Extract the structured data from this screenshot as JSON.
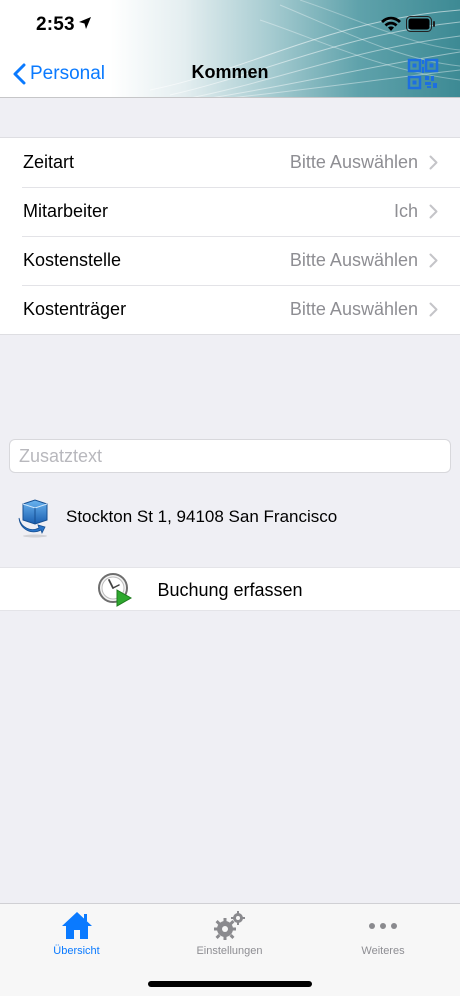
{
  "status_bar": {
    "time": "2:53"
  },
  "nav": {
    "back_label": "Personal",
    "title": "Kommen"
  },
  "form": {
    "rows": [
      {
        "label": "Zeitart",
        "value": "Bitte Auswählen"
      },
      {
        "label": "Mitarbeiter",
        "value": "Ich"
      },
      {
        "label": "Kostenstelle",
        "value": "Bitte Auswählen"
      },
      {
        "label": "Kostenträger",
        "value": "Bitte Auswählen"
      }
    ]
  },
  "extra_text": {
    "placeholder": "Zusatztext",
    "value": ""
  },
  "location": {
    "address": "Stockton St 1, 94108 San Francisco"
  },
  "book_button": {
    "label": "Buchung erfassen"
  },
  "tabbar": {
    "tabs": [
      {
        "label": "Übersicht",
        "icon": "home-icon",
        "active": true
      },
      {
        "label": "Einstellungen",
        "icon": "gears-icon",
        "active": false
      },
      {
        "label": "Weiteres",
        "icon": "more-icon",
        "active": false
      }
    ]
  },
  "colors": {
    "accent": "#0a7aff",
    "header_teal": "#3d8a94",
    "background": "#efeff4",
    "secondary_text": "#8e8e93"
  }
}
